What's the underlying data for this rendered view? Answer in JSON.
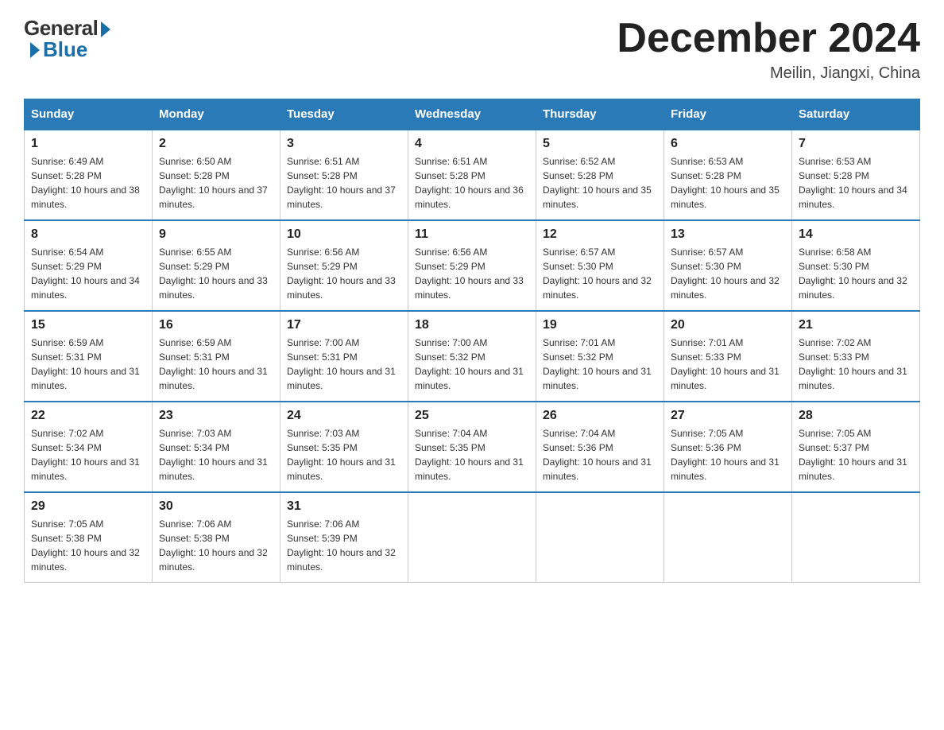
{
  "header": {
    "logo_general": "General",
    "logo_blue": "Blue",
    "title": "December 2024",
    "location": "Meilin, Jiangxi, China"
  },
  "days_of_week": [
    "Sunday",
    "Monday",
    "Tuesday",
    "Wednesday",
    "Thursday",
    "Friday",
    "Saturday"
  ],
  "weeks": [
    [
      {
        "day": "1",
        "sunrise": "6:49 AM",
        "sunset": "5:28 PM",
        "daylight": "10 hours and 38 minutes."
      },
      {
        "day": "2",
        "sunrise": "6:50 AM",
        "sunset": "5:28 PM",
        "daylight": "10 hours and 37 minutes."
      },
      {
        "day": "3",
        "sunrise": "6:51 AM",
        "sunset": "5:28 PM",
        "daylight": "10 hours and 37 minutes."
      },
      {
        "day": "4",
        "sunrise": "6:51 AM",
        "sunset": "5:28 PM",
        "daylight": "10 hours and 36 minutes."
      },
      {
        "day": "5",
        "sunrise": "6:52 AM",
        "sunset": "5:28 PM",
        "daylight": "10 hours and 35 minutes."
      },
      {
        "day": "6",
        "sunrise": "6:53 AM",
        "sunset": "5:28 PM",
        "daylight": "10 hours and 35 minutes."
      },
      {
        "day": "7",
        "sunrise": "6:53 AM",
        "sunset": "5:28 PM",
        "daylight": "10 hours and 34 minutes."
      }
    ],
    [
      {
        "day": "8",
        "sunrise": "6:54 AM",
        "sunset": "5:29 PM",
        "daylight": "10 hours and 34 minutes."
      },
      {
        "day": "9",
        "sunrise": "6:55 AM",
        "sunset": "5:29 PM",
        "daylight": "10 hours and 33 minutes."
      },
      {
        "day": "10",
        "sunrise": "6:56 AM",
        "sunset": "5:29 PM",
        "daylight": "10 hours and 33 minutes."
      },
      {
        "day": "11",
        "sunrise": "6:56 AM",
        "sunset": "5:29 PM",
        "daylight": "10 hours and 33 minutes."
      },
      {
        "day": "12",
        "sunrise": "6:57 AM",
        "sunset": "5:30 PM",
        "daylight": "10 hours and 32 minutes."
      },
      {
        "day": "13",
        "sunrise": "6:57 AM",
        "sunset": "5:30 PM",
        "daylight": "10 hours and 32 minutes."
      },
      {
        "day": "14",
        "sunrise": "6:58 AM",
        "sunset": "5:30 PM",
        "daylight": "10 hours and 32 minutes."
      }
    ],
    [
      {
        "day": "15",
        "sunrise": "6:59 AM",
        "sunset": "5:31 PM",
        "daylight": "10 hours and 31 minutes."
      },
      {
        "day": "16",
        "sunrise": "6:59 AM",
        "sunset": "5:31 PM",
        "daylight": "10 hours and 31 minutes."
      },
      {
        "day": "17",
        "sunrise": "7:00 AM",
        "sunset": "5:31 PM",
        "daylight": "10 hours and 31 minutes."
      },
      {
        "day": "18",
        "sunrise": "7:00 AM",
        "sunset": "5:32 PM",
        "daylight": "10 hours and 31 minutes."
      },
      {
        "day": "19",
        "sunrise": "7:01 AM",
        "sunset": "5:32 PM",
        "daylight": "10 hours and 31 minutes."
      },
      {
        "day": "20",
        "sunrise": "7:01 AM",
        "sunset": "5:33 PM",
        "daylight": "10 hours and 31 minutes."
      },
      {
        "day": "21",
        "sunrise": "7:02 AM",
        "sunset": "5:33 PM",
        "daylight": "10 hours and 31 minutes."
      }
    ],
    [
      {
        "day": "22",
        "sunrise": "7:02 AM",
        "sunset": "5:34 PM",
        "daylight": "10 hours and 31 minutes."
      },
      {
        "day": "23",
        "sunrise": "7:03 AM",
        "sunset": "5:34 PM",
        "daylight": "10 hours and 31 minutes."
      },
      {
        "day": "24",
        "sunrise": "7:03 AM",
        "sunset": "5:35 PM",
        "daylight": "10 hours and 31 minutes."
      },
      {
        "day": "25",
        "sunrise": "7:04 AM",
        "sunset": "5:35 PM",
        "daylight": "10 hours and 31 minutes."
      },
      {
        "day": "26",
        "sunrise": "7:04 AM",
        "sunset": "5:36 PM",
        "daylight": "10 hours and 31 minutes."
      },
      {
        "day": "27",
        "sunrise": "7:05 AM",
        "sunset": "5:36 PM",
        "daylight": "10 hours and 31 minutes."
      },
      {
        "day": "28",
        "sunrise": "7:05 AM",
        "sunset": "5:37 PM",
        "daylight": "10 hours and 31 minutes."
      }
    ],
    [
      {
        "day": "29",
        "sunrise": "7:05 AM",
        "sunset": "5:38 PM",
        "daylight": "10 hours and 32 minutes."
      },
      {
        "day": "30",
        "sunrise": "7:06 AM",
        "sunset": "5:38 PM",
        "daylight": "10 hours and 32 minutes."
      },
      {
        "day": "31",
        "sunrise": "7:06 AM",
        "sunset": "5:39 PM",
        "daylight": "10 hours and 32 minutes."
      },
      null,
      null,
      null,
      null
    ]
  ]
}
